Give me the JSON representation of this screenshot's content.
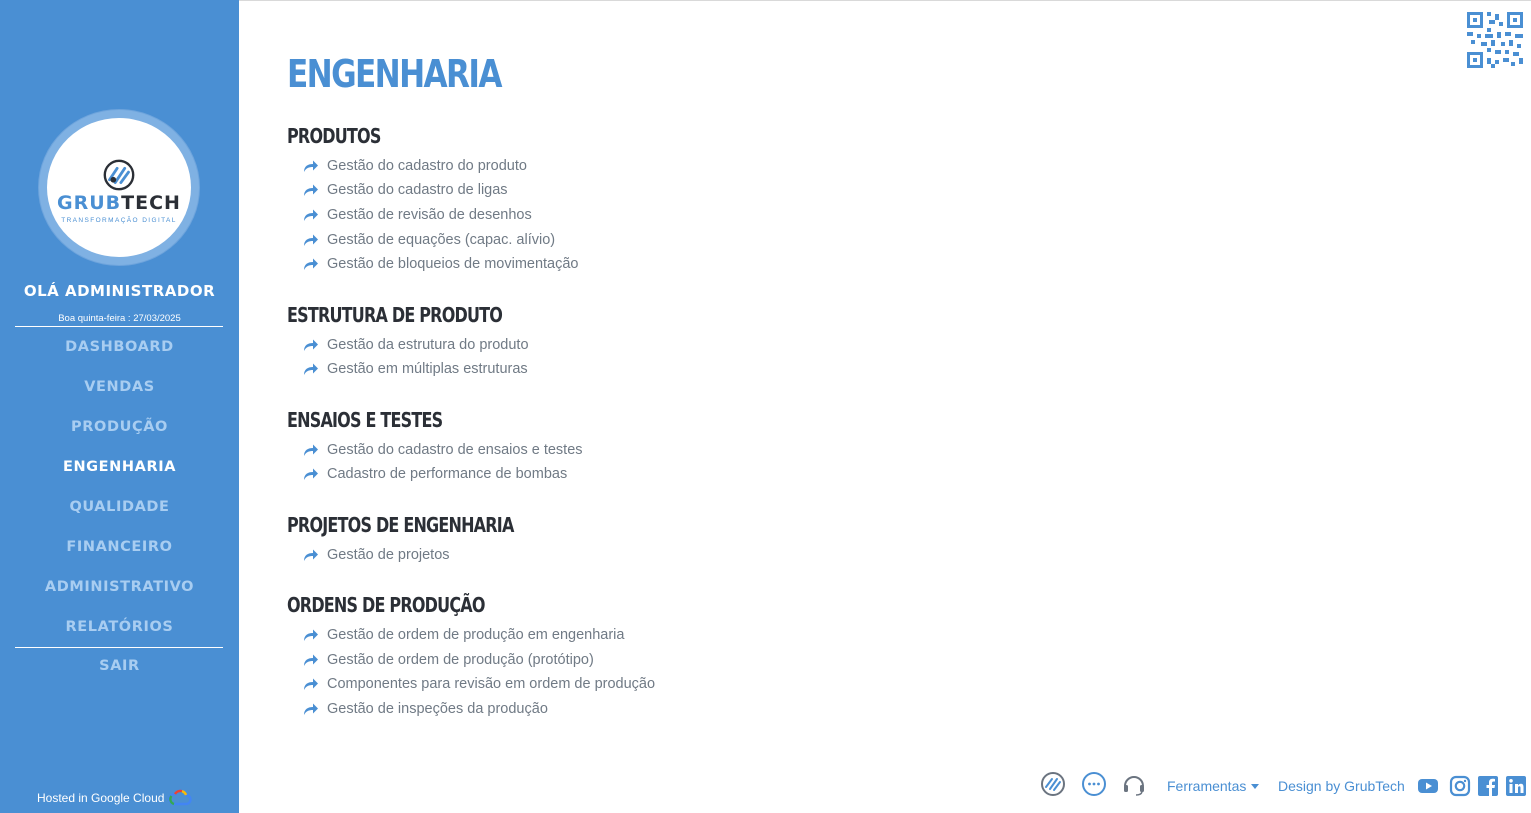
{
  "brand": {
    "logo_word_a": "GRUB",
    "logo_word_b": "TECH",
    "logo_tagline": "TRANSFORMAÇÃO DIGITAL",
    "accent_color": "#4a8fd3"
  },
  "sidebar": {
    "greeting": "OLÁ ADMINISTRADOR",
    "date_line": "Boa quinta-feira : 27/03/2025",
    "items": [
      {
        "label": "DASHBOARD",
        "active": false
      },
      {
        "label": "VENDAS",
        "active": false
      },
      {
        "label": "PRODUÇÃO",
        "active": false
      },
      {
        "label": "ENGENHARIA",
        "active": true
      },
      {
        "label": "QUALIDADE",
        "active": false
      },
      {
        "label": "FINANCEIRO",
        "active": false
      },
      {
        "label": "ADMINISTRATIVO",
        "active": false
      },
      {
        "label": "RELATÓRIOS",
        "active": false
      }
    ],
    "logout_label": "SAIR",
    "hosted_label": "Hosted in Google Cloud"
  },
  "main": {
    "title": "ENGENHARIA",
    "sections": [
      {
        "title": "PRODUTOS",
        "links": [
          "Gestão do cadastro do produto",
          "Gestão do cadastro de ligas",
          "Gestão de revisão de desenhos",
          "Gestão de equações (capac. alívio)",
          "Gestão de bloqueios de movimentação"
        ]
      },
      {
        "title": "ESTRUTURA DE PRODUTO",
        "links": [
          "Gestão da estrutura do produto",
          "Gestão em múltiplas estruturas"
        ]
      },
      {
        "title": "ENSAIOS E TESTES",
        "links": [
          "Gestão do cadastro de ensaios e testes",
          "Cadastro de performance de bombas"
        ]
      },
      {
        "title": "PROJETOS DE ENGENHARIA",
        "links": [
          "Gestão de projetos"
        ]
      },
      {
        "title": "ORDENS DE PRODUÇÃO",
        "links": [
          "Gestão de ordem de produção em engenharia",
          "Gestão de ordem de produção (protótipo)",
          "Componentes para revisão em ordem de produção",
          "Gestão de inspeções da produção"
        ]
      }
    ]
  },
  "footer": {
    "tools_label": "Ferramentas",
    "design_label": "Design by GrubTech",
    "icons": [
      "grubtech-icon",
      "chat-icon",
      "headset-icon"
    ],
    "social": [
      "youtube-icon",
      "instagram-icon",
      "facebook-icon",
      "linkedin-icon"
    ]
  }
}
